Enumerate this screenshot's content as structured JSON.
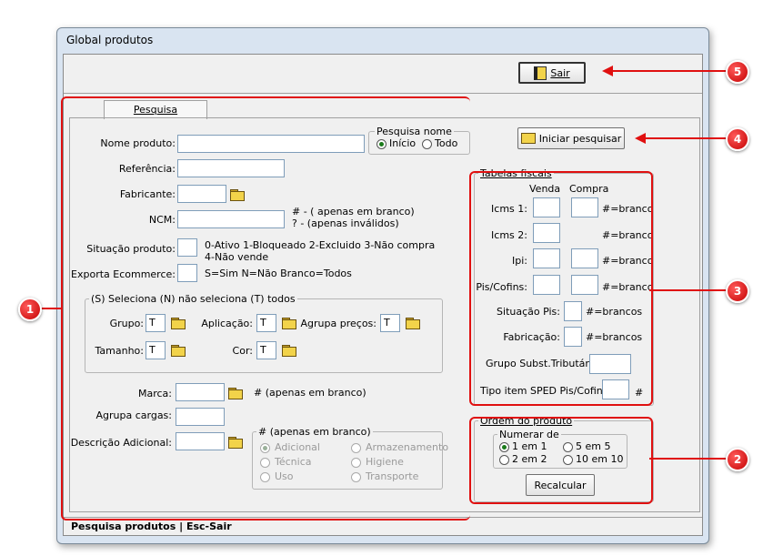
{
  "window": {
    "title": "Global produtos"
  },
  "toolbar": {
    "exit_label": "Sair"
  },
  "tab": {
    "label": "Pesquisa"
  },
  "form": {
    "nome_produto": "Nome produto:",
    "referencia": "Referência:",
    "fabricante": "Fabricante:",
    "ncm": "NCM:",
    "ncm_hint1": "# - ( apenas em branco)",
    "ncm_hint2": "? - (apenas inválidos)",
    "situacao_produto": "Situação produto:",
    "situacao_hint1": "0-Ativo 1-Bloqueado 2-Excluido 3-Não compra",
    "situacao_hint2": "4-Não vende",
    "exporta": "Exporta Ecommerce:",
    "exporta_hint": "S=Sim  N=Não  Branco=Todos",
    "pesquisa_nome": {
      "legend": "Pesquisa nome",
      "inicio": "Início",
      "todo": "Todo"
    },
    "iniciar_pesquisar": "Iniciar pesquisar"
  },
  "selection_group": {
    "legend": "(S) Seleciona (N) não seleciona (T) todos",
    "grupo": "Grupo:",
    "aplicacao": "Aplicação:",
    "agrupa_precos": "Agrupa preços:",
    "tamanho": "Tamanho:",
    "cor": "Cor:",
    "default_value": "T"
  },
  "lower": {
    "marca": "Marca:",
    "marca_hint": "#  (apenas em branco)",
    "agrupa_cargas": "Agrupa cargas:",
    "descricao_adicional": "Descrição Adicional:",
    "desc_group": {
      "legend": "# (apenas em branco)",
      "options": [
        "Adicional",
        "Armazenamento",
        "Técnica",
        "Higiene",
        "Uso",
        "Transporte"
      ]
    }
  },
  "tabelas_fiscais": {
    "legend": "Tabelas fiscais",
    "venda": "Venda",
    "compra": "Compra",
    "icms1": "Icms 1:",
    "icms2": "Icms 2:",
    "ipi": "Ipi:",
    "pis_cofins": "Pis/Cofins:",
    "branco": "#=branco",
    "situacao_pis": "Situação Pis:",
    "fabricacao": "Fabricação:",
    "brancos": "#=brancos",
    "grupo_subst": "Grupo Subst.Tributária:",
    "tipo_item": "Tipo item SPED Pis/Cofins:",
    "hash": "#"
  },
  "ordem_produto": {
    "legend": "Ordem do produto",
    "numerar_de": "Numerar de",
    "options": [
      "1 em 1",
      "5 em 5",
      "2 em 2",
      "10 em 10"
    ],
    "recalcular": "Recalcular"
  },
  "status": {
    "text": "Pesquisa produtos  |  Esc-Sair"
  },
  "callouts": [
    "1",
    "2",
    "3",
    "4",
    "5"
  ],
  "colors": {
    "callout": "#e01010",
    "window_frame": "#d9e4f1"
  }
}
